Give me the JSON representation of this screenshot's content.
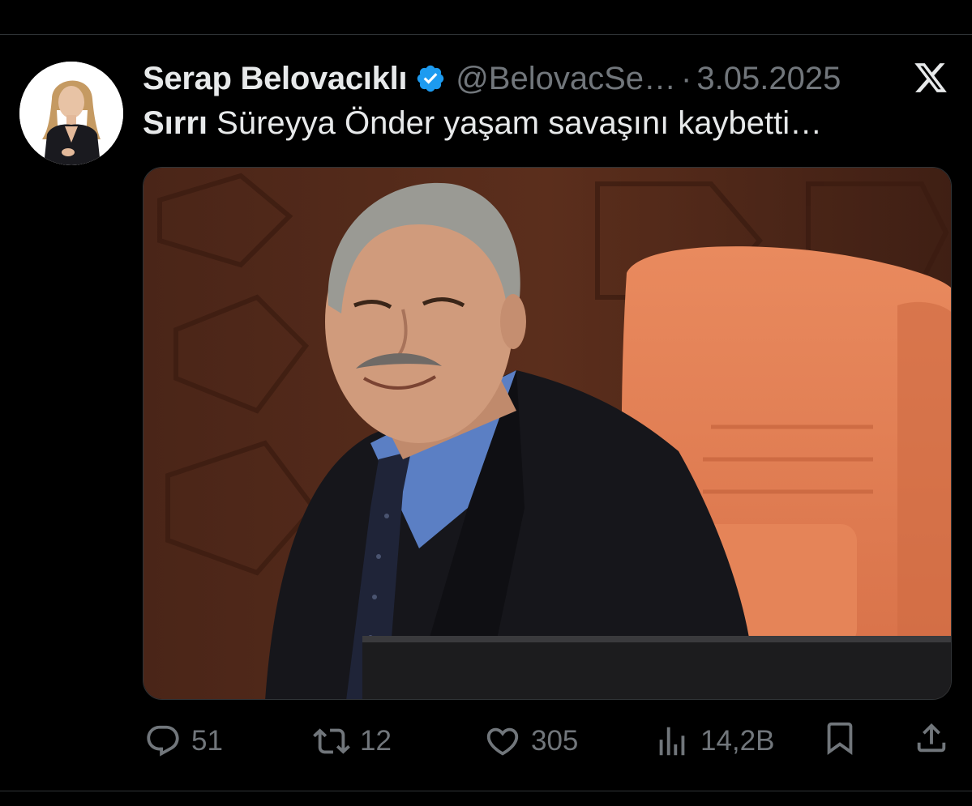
{
  "tweet": {
    "author": {
      "display_name": "Serap Belovacıklı",
      "handle": "@BelovacSe…",
      "verified": true
    },
    "separator": "·",
    "date": "3.05.2025",
    "text_bold": "Sırrı",
    "text_rest": " Süreyya Önder yaşam savaşını kaybetti…"
  },
  "metrics": {
    "replies": "51",
    "reposts": "12",
    "likes": "305",
    "views": "14,2B"
  },
  "colors": {
    "background": "#000000",
    "text_primary": "#e7e9ea",
    "text_secondary": "#71767b",
    "verified_badge": "#1d9bf0"
  },
  "icons": [
    "x-logo-icon",
    "verified-badge-icon",
    "reply-icon",
    "repost-icon",
    "like-icon",
    "views-icon",
    "bookmark-icon",
    "share-icon"
  ]
}
